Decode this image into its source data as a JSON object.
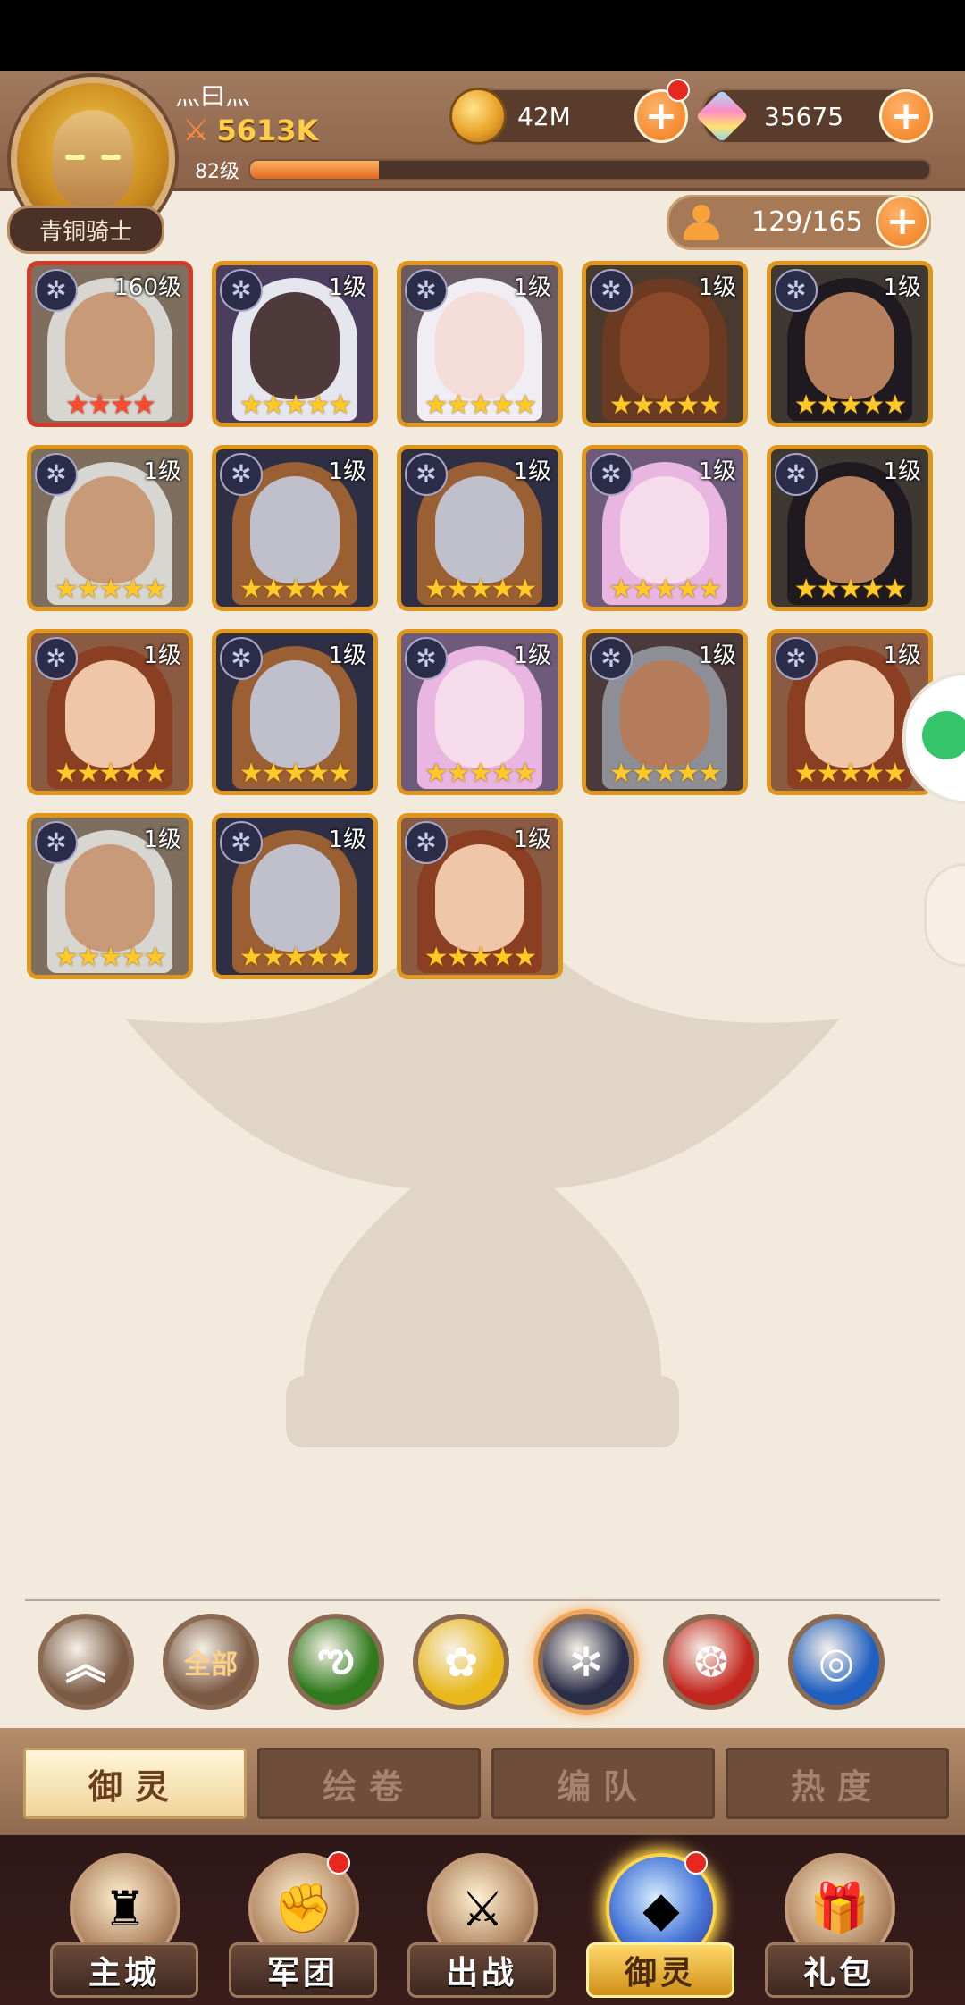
{
  "player": {
    "name": "灬曰灬",
    "power": "5613K",
    "level": "82级",
    "xp_fraction": 0.19,
    "rank": "青铜骑士"
  },
  "currency": {
    "gold": "42M",
    "gems": "35675",
    "plus": "+"
  },
  "slots": {
    "count": "129/165"
  },
  "heroes": [
    {
      "level": "160级",
      "stars": "★★★★",
      "rarity": "red",
      "portrait": "old-man-glasses",
      "faction_icon": "✲"
    },
    {
      "level": "1级",
      "stars": "★★★★★",
      "rarity": "gold",
      "portrait": "dark-elf-white-hair",
      "faction_icon": "✲"
    },
    {
      "level": "1级",
      "stars": "★★★★★",
      "rarity": "gold",
      "portrait": "white-hair-girl",
      "faction_icon": "✲"
    },
    {
      "level": "1级",
      "stars": "★★★★★",
      "rarity": "gold",
      "portrait": "minotaur",
      "faction_icon": "✲"
    },
    {
      "level": "1级",
      "stars": "★★★★★",
      "rarity": "gold",
      "portrait": "egyptian-woman",
      "faction_icon": "✲"
    },
    {
      "level": "1级",
      "stars": "★★★★★",
      "rarity": "gold",
      "portrait": "old-man-glasses",
      "faction_icon": "✲"
    },
    {
      "level": "1级",
      "stars": "★★★★★",
      "rarity": "gold",
      "portrait": "masked-man",
      "faction_icon": "✲"
    },
    {
      "level": "1级",
      "stars": "★★★★★",
      "rarity": "gold",
      "portrait": "masked-man",
      "faction_icon": "✲"
    },
    {
      "level": "1级",
      "stars": "★★★★★",
      "rarity": "gold",
      "portrait": "pink-horned-girl",
      "faction_icon": "✲"
    },
    {
      "level": "1级",
      "stars": "★★★★★",
      "rarity": "gold",
      "portrait": "egyptian-woman",
      "faction_icon": "✲"
    },
    {
      "level": "1级",
      "stars": "★★★★★",
      "rarity": "gold",
      "portrait": "laurel-woman",
      "faction_icon": "✲"
    },
    {
      "level": "1级",
      "stars": "★★★★★",
      "rarity": "gold",
      "portrait": "masked-man",
      "faction_icon": "✲"
    },
    {
      "level": "1级",
      "stars": "★★★★★",
      "rarity": "gold",
      "portrait": "pink-horned-girl",
      "faction_icon": "✲"
    },
    {
      "level": "1级",
      "stars": "★★★★★",
      "rarity": "gold",
      "portrait": "hooded-man",
      "faction_icon": "✲"
    },
    {
      "level": "1级",
      "stars": "★★★★★",
      "rarity": "gold",
      "portrait": "laurel-woman",
      "faction_icon": "✲"
    },
    {
      "level": "1级",
      "stars": "★★★★★",
      "rarity": "gold",
      "portrait": "old-man-glasses",
      "faction_icon": "✲"
    },
    {
      "level": "1级",
      "stars": "★★★★★",
      "rarity": "gold",
      "portrait": "masked-man",
      "faction_icon": "✲"
    },
    {
      "level": "1级",
      "stars": "★★★★★",
      "rarity": "gold",
      "portrait": "laurel-woman",
      "faction_icon": "✲"
    }
  ],
  "filters": [
    {
      "name": "collapse-up-icon",
      "label": "︽",
      "bg": "#7a5a44",
      "selected": false
    },
    {
      "name": "filter-all",
      "label": "全部",
      "bg": "#7a5a44",
      "selected": false
    },
    {
      "name": "nature-faction-icon",
      "label": "ఌ",
      "bg": "#2f7a1c",
      "selected": false
    },
    {
      "name": "light-faction-icon",
      "label": "✿",
      "bg": "#e8b81c",
      "selected": false
    },
    {
      "name": "dark-faction-icon",
      "label": "✲",
      "bg": "#2b2c47",
      "selected": true
    },
    {
      "name": "fire-faction-icon",
      "label": "❂",
      "bg": "#c2261e",
      "selected": false
    },
    {
      "name": "water-faction-icon",
      "label": "◎",
      "bg": "#1f5fc0",
      "selected": false
    }
  ],
  "tabs": [
    {
      "label": "御灵",
      "active": true
    },
    {
      "label": "绘卷",
      "active": false
    },
    {
      "label": "编队",
      "active": false
    },
    {
      "label": "热度",
      "active": false
    }
  ],
  "nav": [
    {
      "label": "主城",
      "icon": "angel-statue-icon",
      "glyph": "♜",
      "active": false,
      "badge": false
    },
    {
      "label": "军团",
      "icon": "fist-shield-icon",
      "glyph": "✊",
      "active": false,
      "badge": true
    },
    {
      "label": "出战",
      "icon": "battle-gate-icon",
      "glyph": "⚔",
      "active": false,
      "badge": false
    },
    {
      "label": "御灵",
      "icon": "crystal-icon",
      "glyph": "◆",
      "active": true,
      "badge": true
    },
    {
      "label": "礼包",
      "icon": "shop-stall-icon",
      "glyph": "🎁",
      "active": false,
      "badge": false
    }
  ],
  "colors": {
    "accent": "#f07a1a",
    "gold_frame": "#e0961a",
    "red_frame": "#d43a2a",
    "background": "#f2eadc"
  }
}
